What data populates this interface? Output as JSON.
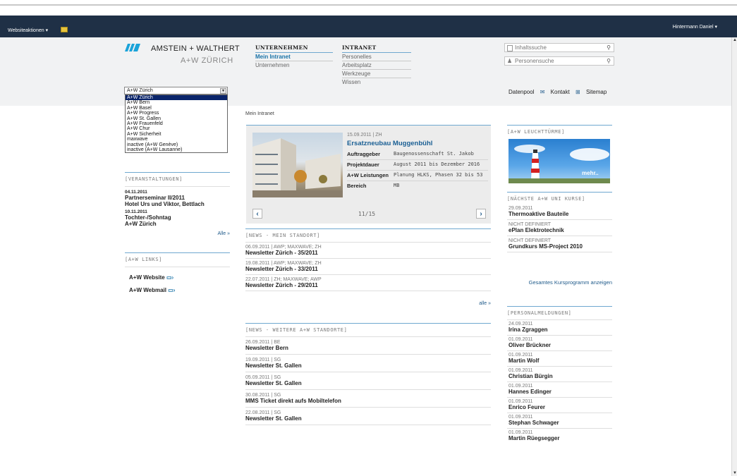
{
  "ribbon": {
    "site_actions": "Websiteaktionen ▾",
    "user": "Hintermann Daniel ▾"
  },
  "logo": {
    "name": "AMSTEIN + WALTHERT",
    "sub": "A+W ZÜRICH"
  },
  "nav": {
    "unternehmen": {
      "heading": "UNTERNEHMEN",
      "items": [
        "Mein Intranet",
        "Unternehmen"
      ]
    },
    "intranet": {
      "heading": "INTRANET",
      "items": [
        "Personelles",
        "Arbeitsplatz",
        "Werkzeuge",
        "Wissen"
      ]
    }
  },
  "search": {
    "content_placeholder": "Inhaltssuche",
    "people_placeholder": "Personensuche"
  },
  "toplinks": [
    "Datenpool",
    "Kontakt",
    "Sitemap"
  ],
  "location_select": {
    "value": "A+W Zürich",
    "options": [
      "A+W Zürich",
      "A+W Bern",
      "A+W Basel",
      "A+W Progress",
      "A+W St. Gallen",
      "A+W Frauenfeld",
      "A+W Chur",
      "A+W Sicherheit",
      "maxwave",
      "inactive (A+W Genève)",
      "inactive (A+W Lausanne)"
    ]
  },
  "breadcrumb": "Mein Intranet",
  "events": {
    "heading": "[VERANSTALTUNGEN]",
    "items": [
      {
        "date": "04.11.2011",
        "title": "Partnerseminar II/2011",
        "sub": "Hotel Urs und Viktor, Bettlach"
      },
      {
        "date": "10.11.2011",
        "title": "Tochter-/Sohntag",
        "sub": "A+W Zürich"
      }
    ],
    "all": "Alle »"
  },
  "links": {
    "heading": "[A+W LINKS]",
    "items": [
      "A+W Website",
      "A+W Webmail"
    ]
  },
  "carousel": {
    "meta": "15.09.2011 | ZH",
    "title": "Ersatzneubau Muggenbühl",
    "rows": [
      {
        "k": "Auftraggeber",
        "v": "Baugenossenschaft St. Jakob"
      },
      {
        "k": "Projektdauer",
        "v": "August 2011 bis Dezember 2016"
      },
      {
        "k": "A+W Leistungen",
        "v": "Planung HLKS, Phasen 32 bis 53"
      },
      {
        "k": "Bereich",
        "v": "MB"
      }
    ],
    "counter": "11/15"
  },
  "news_local": {
    "heading": "[NEWS - MEIN STANDORT]",
    "items": [
      {
        "meta": "06.09.2011 | AWP; MAXWAVE; ZH",
        "title": "Newsletter Zürich - 35/2011"
      },
      {
        "meta": "19.08.2011 | AWP; MAXWAVE; ZH",
        "title": "Newsletter Zürich - 33/2011"
      },
      {
        "meta": "22.07.2011 | ZH; MAXWAVE; AWP",
        "title": "Newsletter Zürich - 29/2011"
      }
    ],
    "all": "alle »"
  },
  "news_other": {
    "heading": "[NEWS - WEITERE A+W STANDORTE]",
    "items": [
      {
        "meta": "26.09.2011 | BE",
        "title": "Newsletter Bern"
      },
      {
        "meta": "19.09.2011 | SG",
        "title": "Newsletter St. Gallen"
      },
      {
        "meta": "05.09.2011 | SG",
        "title": "Newsletter St. Gallen"
      },
      {
        "meta": "30.08.2011 | SG",
        "title": "MMS Ticket direkt aufs Mobiltelefon"
      },
      {
        "meta": "22.08.2011 | SG",
        "title": "Newsletter St. Gallen"
      }
    ]
  },
  "lighthouse": {
    "heading": "[A+W LEUCHTTÜRME]",
    "more": "mehr.."
  },
  "courses": {
    "heading": "[NÄCHSTE A+W UNI KURSE]",
    "items": [
      {
        "date": "29.09.2011",
        "title": "Thermoaktive Bauteile"
      },
      {
        "date": "NICHT DEFINIERT",
        "title": "ePlan Elektrotechnik"
      },
      {
        "date": "NICHT DEFINIERT",
        "title": "Grundkurs MS-Project 2010"
      }
    ],
    "all": "Gesamtes Kursprogramm anzeigen"
  },
  "personnel": {
    "heading": "[PERSONALMELDUNGEN]",
    "items": [
      {
        "date": "24.09.2011",
        "name": "Irina Zgraggen"
      },
      {
        "date": "01.09.2011",
        "name": "Oliver Brückner"
      },
      {
        "date": "01.09.2011",
        "name": "Martin Wolf"
      },
      {
        "date": "01.09.2011",
        "name": "Christian Bürgin"
      },
      {
        "date": "01.09.2011",
        "name": "Hannes Edinger"
      },
      {
        "date": "01.09.2011",
        "name": "Enrico Feurer"
      },
      {
        "date": "01.09.2011",
        "name": "Stephan Schwager"
      },
      {
        "date": "01.09.2011",
        "name": "Martin Rüegsegger"
      }
    ]
  },
  "colors": {
    "ribbon": "#1f3046",
    "accent_blue": "#1a73a8",
    "rule_blue": "#6fa8d0",
    "logo_blue": "#1aa3d9"
  }
}
